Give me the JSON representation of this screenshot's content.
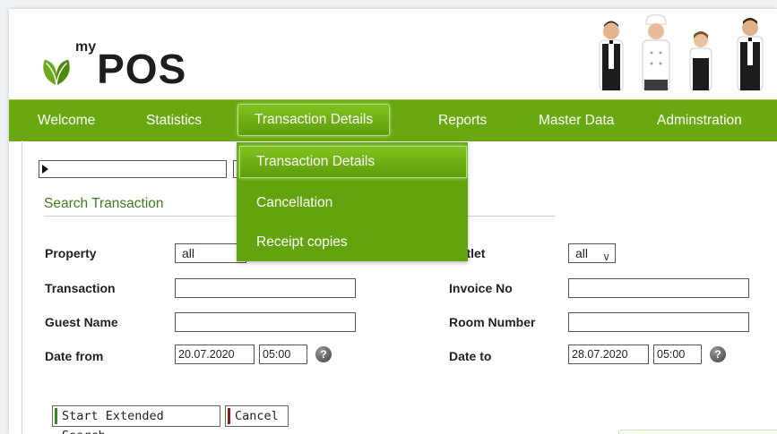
{
  "brand": {
    "my": "my",
    "pos": "POS",
    "leaf_color": "#6aaa1b"
  },
  "colors": {
    "accent": "#69a811",
    "title_green": "#3f7d1e",
    "start_bar": "#3b8a1f",
    "cancel_bar": "#8a1c1c"
  },
  "nav": {
    "items": [
      "Welcome",
      "Statistics",
      "Transaction Details",
      "Reports",
      "Master Data",
      "Adminstration"
    ],
    "active": "Transaction Details"
  },
  "dropdown": {
    "items": [
      "Transaction Details",
      "Cancellation",
      "Receipt copies"
    ],
    "active": "Transaction Details"
  },
  "search": {
    "title": "Search Transaction",
    "property_label": "Property",
    "property_value": "all",
    "outlet_label": "Outlet",
    "outlet_value": "all",
    "transaction_label": "Transaction",
    "invoice_label": "Invoice No",
    "guest_label": "Guest Name",
    "room_label": "Room Number",
    "date_from_label": "Date from",
    "date_from_value": "20.07.2020",
    "date_from_time": "05:00",
    "date_to_label": "Date to",
    "date_to_value": "28.07.2020",
    "date_to_time": "05:00",
    "help_glyph": "?"
  },
  "buttons": {
    "start": "Start Extended Search",
    "cancel": "Cancel"
  },
  "icons": {
    "help": "help-icon",
    "expand": "expand-triangle-icon",
    "chevron": "chevron-down-icon"
  }
}
